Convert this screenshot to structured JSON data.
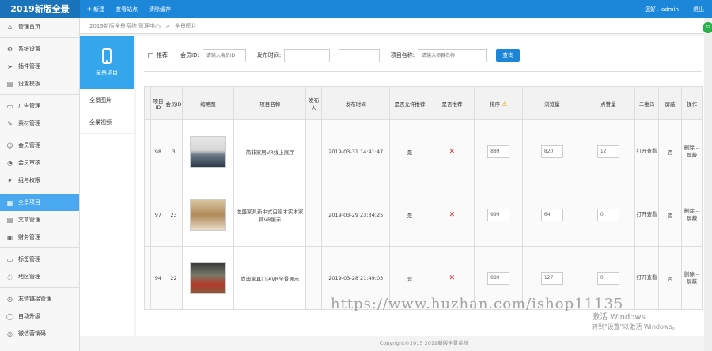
{
  "app": {
    "logo": "2019新版全景"
  },
  "topnav": [
    {
      "icon": "plus-icon",
      "label": "新建"
    },
    {
      "label": "查看站点"
    },
    {
      "label": "清除缓存"
    }
  ],
  "topright": {
    "greeting": "您好，admin",
    "logout": "退出"
  },
  "sidebar": [
    {
      "icon": "home-icon",
      "label": "管理首页"
    },
    {
      "sep": true
    },
    {
      "icon": "gear-icon",
      "label": "系统设置"
    },
    {
      "icon": "plugin-icon",
      "label": "插件管理"
    },
    {
      "icon": "template-icon",
      "label": "设置模板"
    },
    {
      "sep": true
    },
    {
      "icon": "ad-icon",
      "label": "广告管理"
    },
    {
      "icon": "material-icon",
      "label": "素材管理"
    },
    {
      "sep": true
    },
    {
      "icon": "user-icon",
      "label": "会员管理"
    },
    {
      "icon": "member-audit-icon",
      "label": "会员审核"
    },
    {
      "icon": "group-icon",
      "label": "组与权限"
    },
    {
      "sep": true
    },
    {
      "icon": "panorama-icon",
      "label": "全景项目",
      "active": true
    },
    {
      "icon": "article-icon",
      "label": "文章管理"
    },
    {
      "icon": "finance-icon",
      "label": "财务管理"
    },
    {
      "sep": true
    },
    {
      "icon": "tag-icon",
      "label": "标签管理"
    },
    {
      "icon": "region-icon",
      "label": "地区管理"
    },
    {
      "sep": true
    },
    {
      "icon": "link-icon",
      "label": "友情链接管理"
    },
    {
      "icon": "upgrade-icon",
      "label": "自动升级"
    },
    {
      "icon": "wechat-icon",
      "label": "微信营销码"
    }
  ],
  "breadcrumb": {
    "system": "2019新版全景系统 管理中心",
    "sep": ">",
    "current": "全景图片"
  },
  "leftpanel": {
    "title": "全景项目",
    "items": [
      "全景图片",
      "全景视频"
    ]
  },
  "filter": {
    "recommend": "推荐",
    "member_label": "会员ID:",
    "member_placeholder": "请输入会员ID",
    "time_label": "发布时间:",
    "dash": "-",
    "name_label": "项目名称:",
    "name_placeholder": "请输入项目名称",
    "query": "查询"
  },
  "table": {
    "headers": [
      "",
      "项目ID",
      "会员ID",
      "缩略图",
      "项目名称",
      "发布人",
      "发布时间",
      "是否允许推荐",
      "是否推荐",
      "排序",
      "浏览量",
      "点赞量",
      "二维码",
      "屏蔽",
      "操作"
    ],
    "rows": [
      {
        "pid": "98",
        "mid": "3",
        "thumb": "t1",
        "name": "简非家居VR线上展厅",
        "publisher": "",
        "time": "2019-03-31 14:41:47",
        "allow": "是",
        "sort": "889",
        "views": "820",
        "likes": "12",
        "qr": "打开查看",
        "block": "否",
        "ops": "删除 -- 屏蔽"
      },
      {
        "pid": "97",
        "mid": "23",
        "thumb": "t2",
        "name": "龙盛家具新中式白蜡木实木家具VR展示",
        "publisher": "",
        "time": "2019-03-29 23:34:25",
        "allow": "是",
        "sort": "999",
        "views": "64",
        "likes": "0",
        "qr": "打开查看",
        "block": "否",
        "ops": "删除 -- 屏蔽"
      },
      {
        "pid": "94",
        "mid": "22",
        "thumb": "t3",
        "name": "尚典家具门店VR全景展示",
        "publisher": "",
        "time": "2019-03-28 21:49:03",
        "allow": "是",
        "sort": "889",
        "views": "127",
        "likes": "0",
        "qr": "打开查看",
        "block": "否",
        "ops": "删除 -- 屏蔽"
      }
    ]
  },
  "footer": "Copyright©2015  2019新版全景系统",
  "badge": "67",
  "watermark": "https://www.huzhan.com/ishop11135",
  "activate": {
    "title": "激活 Windows",
    "sub": "转到\"设置\"以激活 Windows。"
  },
  "colors": {
    "primary": "#1c86d8",
    "active": "#49a8f0",
    "panel_head": "#36a6ec"
  }
}
